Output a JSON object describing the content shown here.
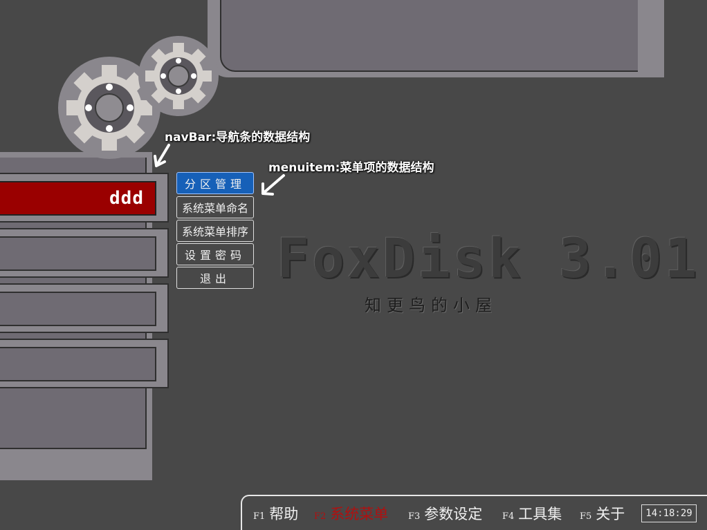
{
  "annotations": {
    "navbar_note": "navBar:导航条的数据结构",
    "menuitem_note": "menuitem:菜单项的数据结构"
  },
  "nav_bar": {
    "items": [
      {
        "label": "ddd",
        "active": true
      },
      {
        "label": ""
      },
      {
        "label": ""
      },
      {
        "label": ""
      }
    ]
  },
  "menu": {
    "items": [
      {
        "label": "分区管理",
        "active": true
      },
      {
        "label": "系统菜单命名"
      },
      {
        "label": "系统菜单排序"
      },
      {
        "label": "设置密码"
      },
      {
        "label": "退出"
      }
    ]
  },
  "app": {
    "title": "FoxDisk 3.01",
    "subtitle": "知更鸟的小屋"
  },
  "status_bar": {
    "keys": [
      {
        "key": "F1",
        "label": "帮助"
      },
      {
        "key": "F2",
        "label": "系统菜单",
        "active": true
      },
      {
        "key": "F3",
        "label": "参数设定"
      },
      {
        "key": "F4",
        "label": "工具集"
      },
      {
        "key": "F5",
        "label": "关于"
      }
    ],
    "clock": "14:18:29"
  },
  "colors": {
    "background": "#484848",
    "frame": "#8a878d",
    "nav_active": "#9a0000",
    "menu_active": "#1660b8",
    "fkey_active": "#b01010"
  }
}
